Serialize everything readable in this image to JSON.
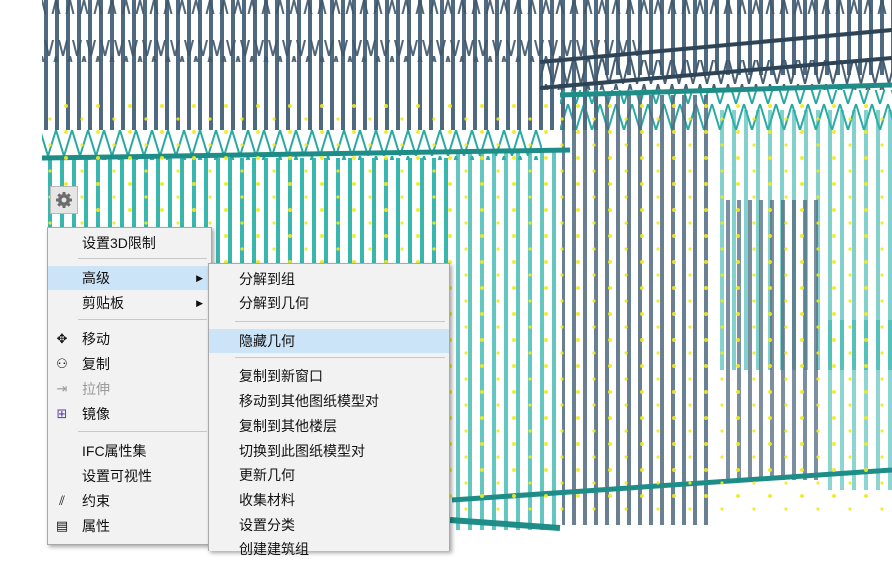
{
  "main_menu": {
    "items": [
      {
        "label": "设置3D限制"
      },
      {
        "label": "高级"
      },
      {
        "label": "剪贴板"
      },
      {
        "label": "移动"
      },
      {
        "label": "复制"
      },
      {
        "label": "拉伸"
      },
      {
        "label": "镜像"
      },
      {
        "label": "IFC属性集"
      },
      {
        "label": "设置可视性"
      },
      {
        "label": "约束"
      },
      {
        "label": "属性"
      }
    ]
  },
  "sub_menu": {
    "items": [
      {
        "label": "分解到组"
      },
      {
        "label": "分解到几何"
      },
      {
        "label": "隐藏几何"
      },
      {
        "label": "复制到新窗口"
      },
      {
        "label": "移动到其他图纸模型对"
      },
      {
        "label": "复制到其他楼层"
      },
      {
        "label": "切换到此图纸模型对"
      },
      {
        "label": "更新几何"
      },
      {
        "label": "收集材料"
      },
      {
        "label": "设置分类"
      },
      {
        "label": "创建建筑组"
      }
    ]
  },
  "colors": {
    "steel_dark": "#3c5468",
    "steel_teal": "#2fb3ab",
    "node_yellow": "#f2ea1c",
    "menu_highlight": "#cce4f7",
    "menu_bg": "#f2f2f2"
  }
}
